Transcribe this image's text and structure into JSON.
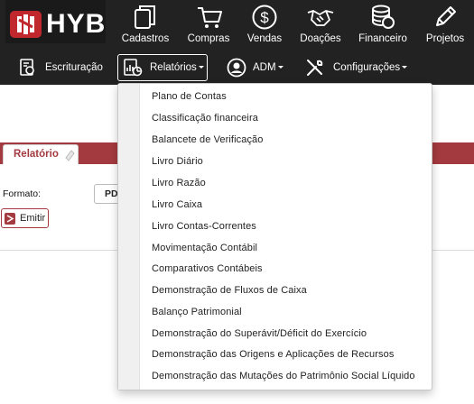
{
  "brand": {
    "name": "HYB"
  },
  "top_nav": [
    {
      "label": "Cadastros",
      "icon": "copy-icon"
    },
    {
      "label": "Compras",
      "icon": "cart-icon"
    },
    {
      "label": "Vendas",
      "icon": "dollar-icon"
    },
    {
      "label": "Doações",
      "icon": "handshake-icon"
    },
    {
      "label": "Financeiro",
      "icon": "coins-icon"
    },
    {
      "label": "Projetos",
      "icon": "pencil-icon"
    }
  ],
  "sub_nav": [
    {
      "label": "Escrituração",
      "icon": "ledger-icon"
    },
    {
      "label": "Relatórios",
      "icon": "report-chart-icon",
      "active": true
    },
    {
      "label": "ADM",
      "icon": "user-circle-icon"
    },
    {
      "label": "Configurações",
      "icon": "tools-icon"
    }
  ],
  "tab": {
    "label": "Relatório"
  },
  "form": {
    "format_label": "Formato:",
    "format_value": "PD"
  },
  "emit_button": {
    "label": "Emitir"
  },
  "dropdown_items": [
    "Plano de Contas",
    "Classificação financeira",
    "Balancete de Verificação",
    "Livro Diário",
    "Livro Razão",
    "Livro Caixa",
    "Livro Contas-Correntes",
    "Movimentação Contábil",
    "Comparativos Contábeis",
    "Demonstração de Fluxos de Caixa",
    "Balanço Patrimonial",
    "Demonstração do Superávit/Déficit do Exercício",
    "Demonstração das Origens e Aplicações de Recursos",
    "Demonstração das Mutações do Patrimônio Social Líquido"
  ],
  "colors": {
    "nav_bg": "#222222",
    "accent": "#a33a3f",
    "logo_red": "#c0282e"
  }
}
